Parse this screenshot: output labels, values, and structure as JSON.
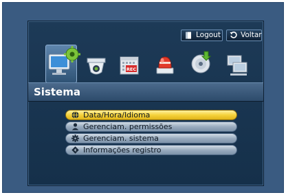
{
  "top_buttons": {
    "logout_label": "Logout",
    "voltar_label": "Voltar"
  },
  "icons": [
    {
      "name": "system-settings-icon",
      "selected": true
    },
    {
      "name": "camera-icon",
      "selected": false
    },
    {
      "name": "record-calendar-icon",
      "selected": false
    },
    {
      "name": "alarm-event-icon",
      "selected": false
    },
    {
      "name": "backup-disc-icon",
      "selected": false
    },
    {
      "name": "network-icon",
      "selected": false
    }
  ],
  "section_title": "Sistema",
  "menu": [
    {
      "label": "Data/Hora/Idioma",
      "icon": "globe-icon",
      "active": true
    },
    {
      "label": "Gerenciam. permissões",
      "icon": "user-icon",
      "active": false
    },
    {
      "label": "Gerenciam. sistema",
      "icon": "gear-icon",
      "active": false
    },
    {
      "label": "Informações registro",
      "icon": "diamond-arrow-icon",
      "active": false
    }
  ],
  "colors": {
    "active_item": "#f5d23c",
    "background": "#15304a",
    "frame": "#3a5b81"
  }
}
